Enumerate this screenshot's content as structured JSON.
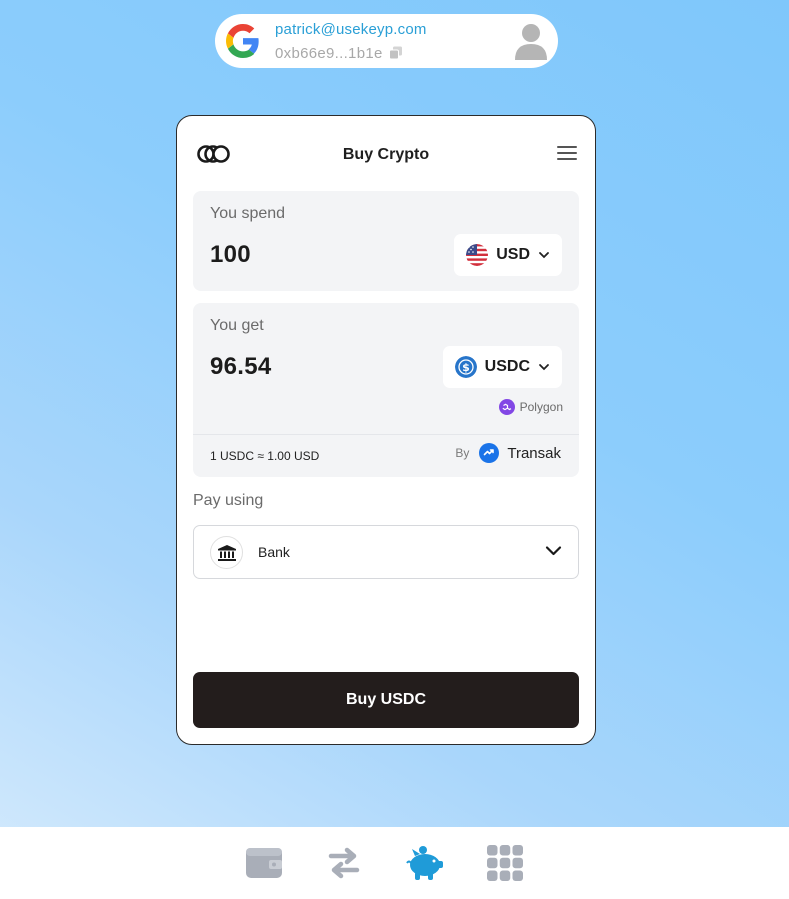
{
  "account": {
    "email": "patrick@usekeyp.com",
    "address": "0xb66e9...1b1e",
    "provider_icon": "google-icon",
    "avatar_icon": "user-avatar-icon"
  },
  "card": {
    "title": "Buy Crypto",
    "spend": {
      "label": "You spend",
      "amount": "100",
      "currency": "USD"
    },
    "get": {
      "label": "You get",
      "amount": "96.54",
      "currency": "USDC",
      "network": "Polygon"
    },
    "rate": "1 USDC ≈ 1.00 USD",
    "provider": {
      "by_label": "By",
      "name": "Transak"
    },
    "pay": {
      "label": "Pay using",
      "method": "Bank"
    },
    "buy_button": "Buy USDC"
  },
  "nav": {
    "items": [
      "wallet-icon",
      "swap-icon",
      "piggy-bank-icon",
      "apps-grid-icon"
    ],
    "active": "piggy-bank-icon",
    "active_color": "#1f9bd8",
    "inactive_color": "#a9aeb8"
  },
  "colors": {
    "accent": "#2a9fd6",
    "button": "#231d1c",
    "panel": "#f3f4f6"
  }
}
